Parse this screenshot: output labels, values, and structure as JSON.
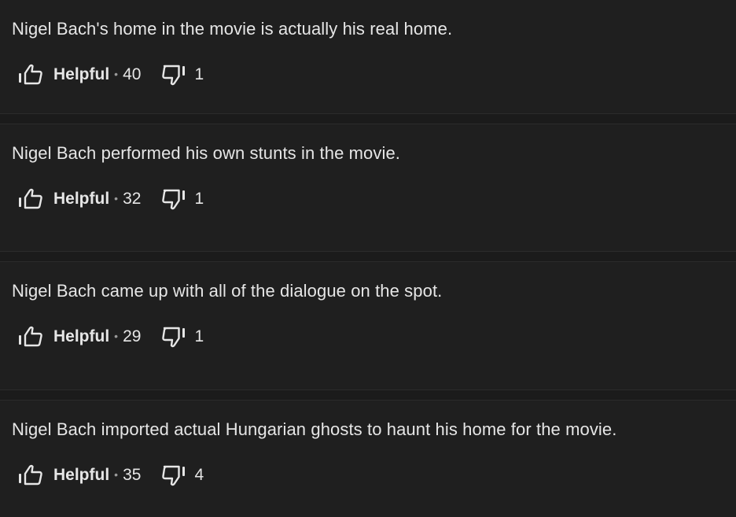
{
  "trivia": [
    {
      "text": "Nigel Bach's home in the movie is actually his real home.",
      "helpful_label": "Helpful",
      "separator": "•",
      "helpful_count": "40",
      "not_helpful_count": "1"
    },
    {
      "text": "Nigel Bach performed his own stunts in the movie.",
      "helpful_label": "Helpful",
      "separator": "•",
      "helpful_count": "32",
      "not_helpful_count": "1"
    },
    {
      "text": "Nigel Bach came up with all of the dialogue on the spot.",
      "helpful_label": "Helpful",
      "separator": "•",
      "helpful_count": "29",
      "not_helpful_count": "1"
    },
    {
      "text": "Nigel Bach imported actual Hungarian ghosts to haunt his home for the movie.",
      "helpful_label": "Helpful",
      "separator": "•",
      "helpful_count": "35",
      "not_helpful_count": "4"
    }
  ],
  "icons": {
    "upvote": "thumbs-up-outline-icon",
    "downvote": "thumbs-down-outline-icon"
  },
  "colors": {
    "background": "#1f1f1f",
    "text": "#e6e6e6",
    "divider": "#1b1b1b"
  }
}
